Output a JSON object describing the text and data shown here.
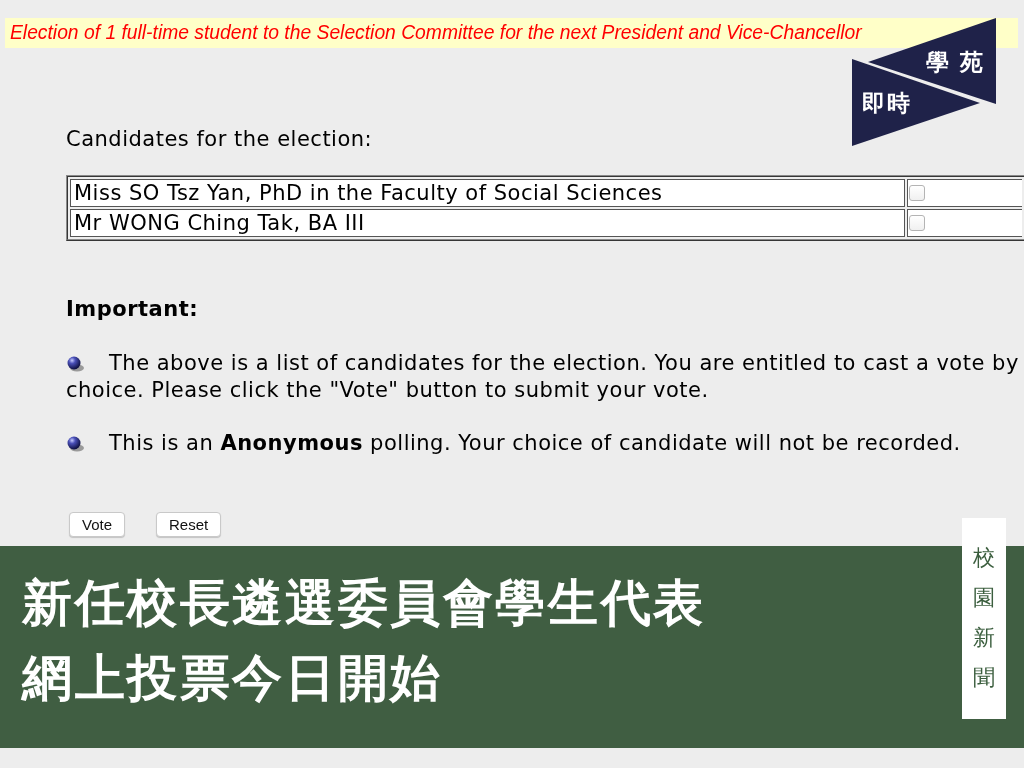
{
  "header": {
    "title": "Election of 1 full-time student to the Selection Committee for the next President and Vice-Chancellor"
  },
  "logo": {
    "top_text": "學苑",
    "bottom_text": "即時"
  },
  "candidates": {
    "heading": "Candidates for the election:",
    "rows": [
      {
        "name": "Miss SO Tsz Yan, PhD in the Faculty of Social Sciences",
        "checked": false
      },
      {
        "name": "Mr WONG Ching Tak, BA III",
        "checked": false
      }
    ]
  },
  "important": {
    "heading": "Important:",
    "notes": [
      {
        "lines": [
          "The above is a list of candidates for the election. You are entitled to cast a vote by",
          "choice. Please click the \"Vote\" button to submit your vote."
        ]
      },
      {
        "lines": [
          "This is an **Anonymous** polling. Your choice of candidate will not be recorded."
        ]
      }
    ]
  },
  "buttons": [
    "Vote",
    "Reset"
  ],
  "news_banner": {
    "headline_lines": [
      "新任校長遴選委員會學生代表",
      "網上投票今日開始"
    ],
    "section_label": "校園新聞"
  }
}
